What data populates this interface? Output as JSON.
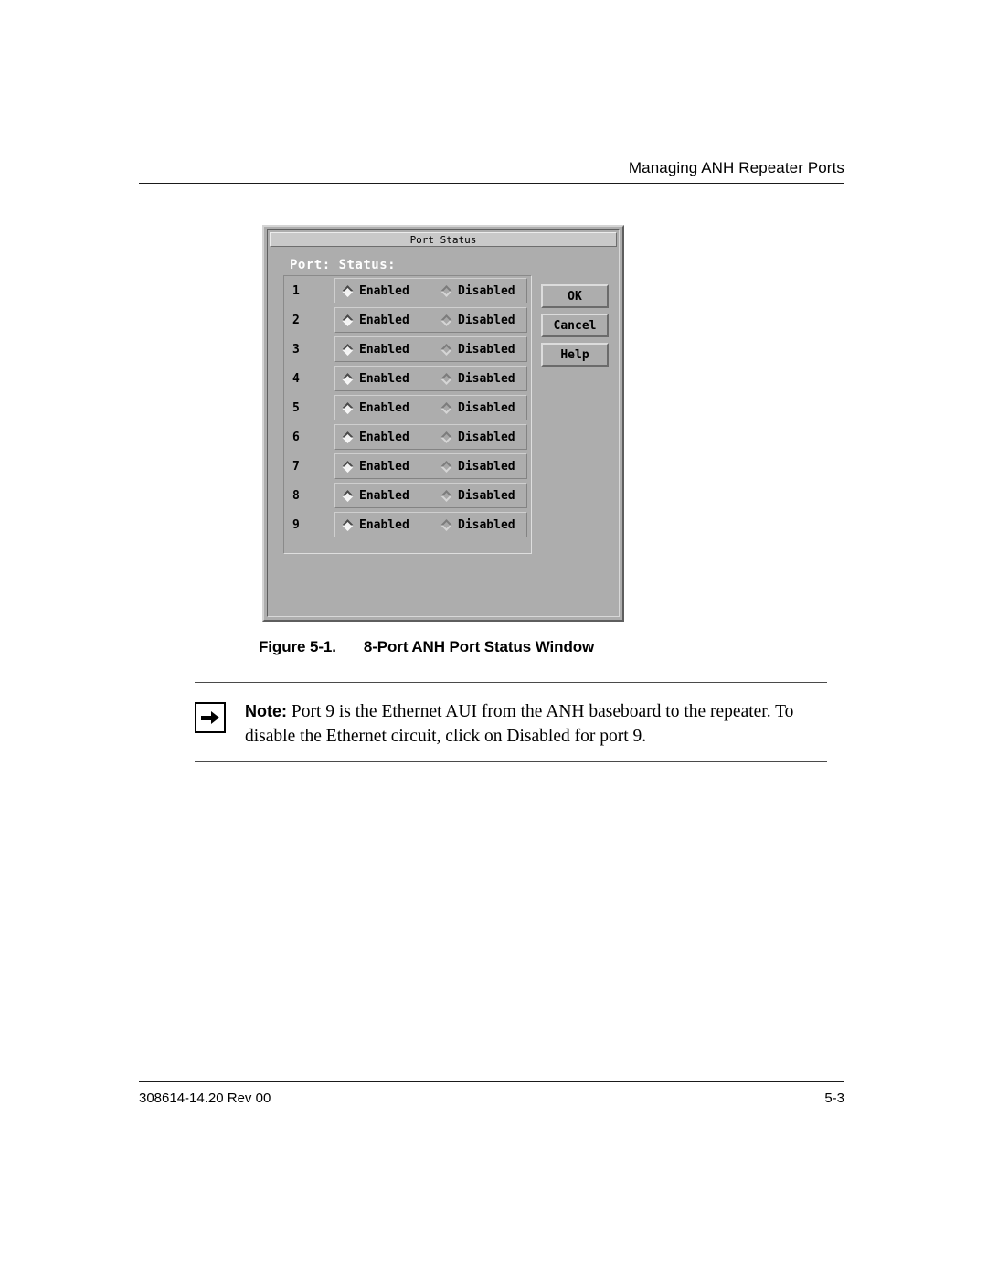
{
  "page": {
    "running_header": "Managing ANH Repeater Ports",
    "figure_caption_number": "Figure 5-1.",
    "figure_caption_title": "8-Port ANH Port Status Window"
  },
  "dialog": {
    "title": "Port Status",
    "section_label": "Port: Status:",
    "column_headers": [
      "Port:",
      "Status:"
    ],
    "option_enabled": "Enabled",
    "option_disabled": "Disabled",
    "rows": [
      {
        "port": "1",
        "enabled_label": "Enabled",
        "disabled_label": "Disabled",
        "selected": "Enabled"
      },
      {
        "port": "2",
        "enabled_label": "Enabled",
        "disabled_label": "Disabled",
        "selected": "Enabled"
      },
      {
        "port": "3",
        "enabled_label": "Enabled",
        "disabled_label": "Disabled",
        "selected": "Enabled"
      },
      {
        "port": "4",
        "enabled_label": "Enabled",
        "disabled_label": "Disabled",
        "selected": "Enabled"
      },
      {
        "port": "5",
        "enabled_label": "Enabled",
        "disabled_label": "Disabled",
        "selected": "Enabled"
      },
      {
        "port": "6",
        "enabled_label": "Enabled",
        "disabled_label": "Disabled",
        "selected": "Enabled"
      },
      {
        "port": "7",
        "enabled_label": "Enabled",
        "disabled_label": "Disabled",
        "selected": "Enabled"
      },
      {
        "port": "8",
        "enabled_label": "Enabled",
        "disabled_label": "Disabled",
        "selected": "Enabled"
      },
      {
        "port": "9",
        "enabled_label": "Enabled",
        "disabled_label": "Disabled",
        "selected": "Enabled"
      }
    ],
    "buttons": [
      {
        "label": "OK",
        "name": "ok-button"
      },
      {
        "label": "Cancel",
        "name": "cancel-button"
      },
      {
        "label": "Help",
        "name": "help-button"
      }
    ],
    "colors": {
      "face": "#adadad",
      "titlebar": "#c9c9c9",
      "shadow": "#5e5e5e",
      "highlight": "#d4d4d4",
      "label_text": "#ffffff"
    }
  },
  "note": {
    "icon": "arrow-right-icon",
    "lead": "Note:",
    "text": " Port 9 is the Ethernet AUI from the ANH baseboard to the repeater. To disable the Ethernet circuit, click on Disabled for port 9."
  },
  "footer": {
    "document_id": "308614-14.20 Rev 00",
    "page_number": "5-3"
  }
}
